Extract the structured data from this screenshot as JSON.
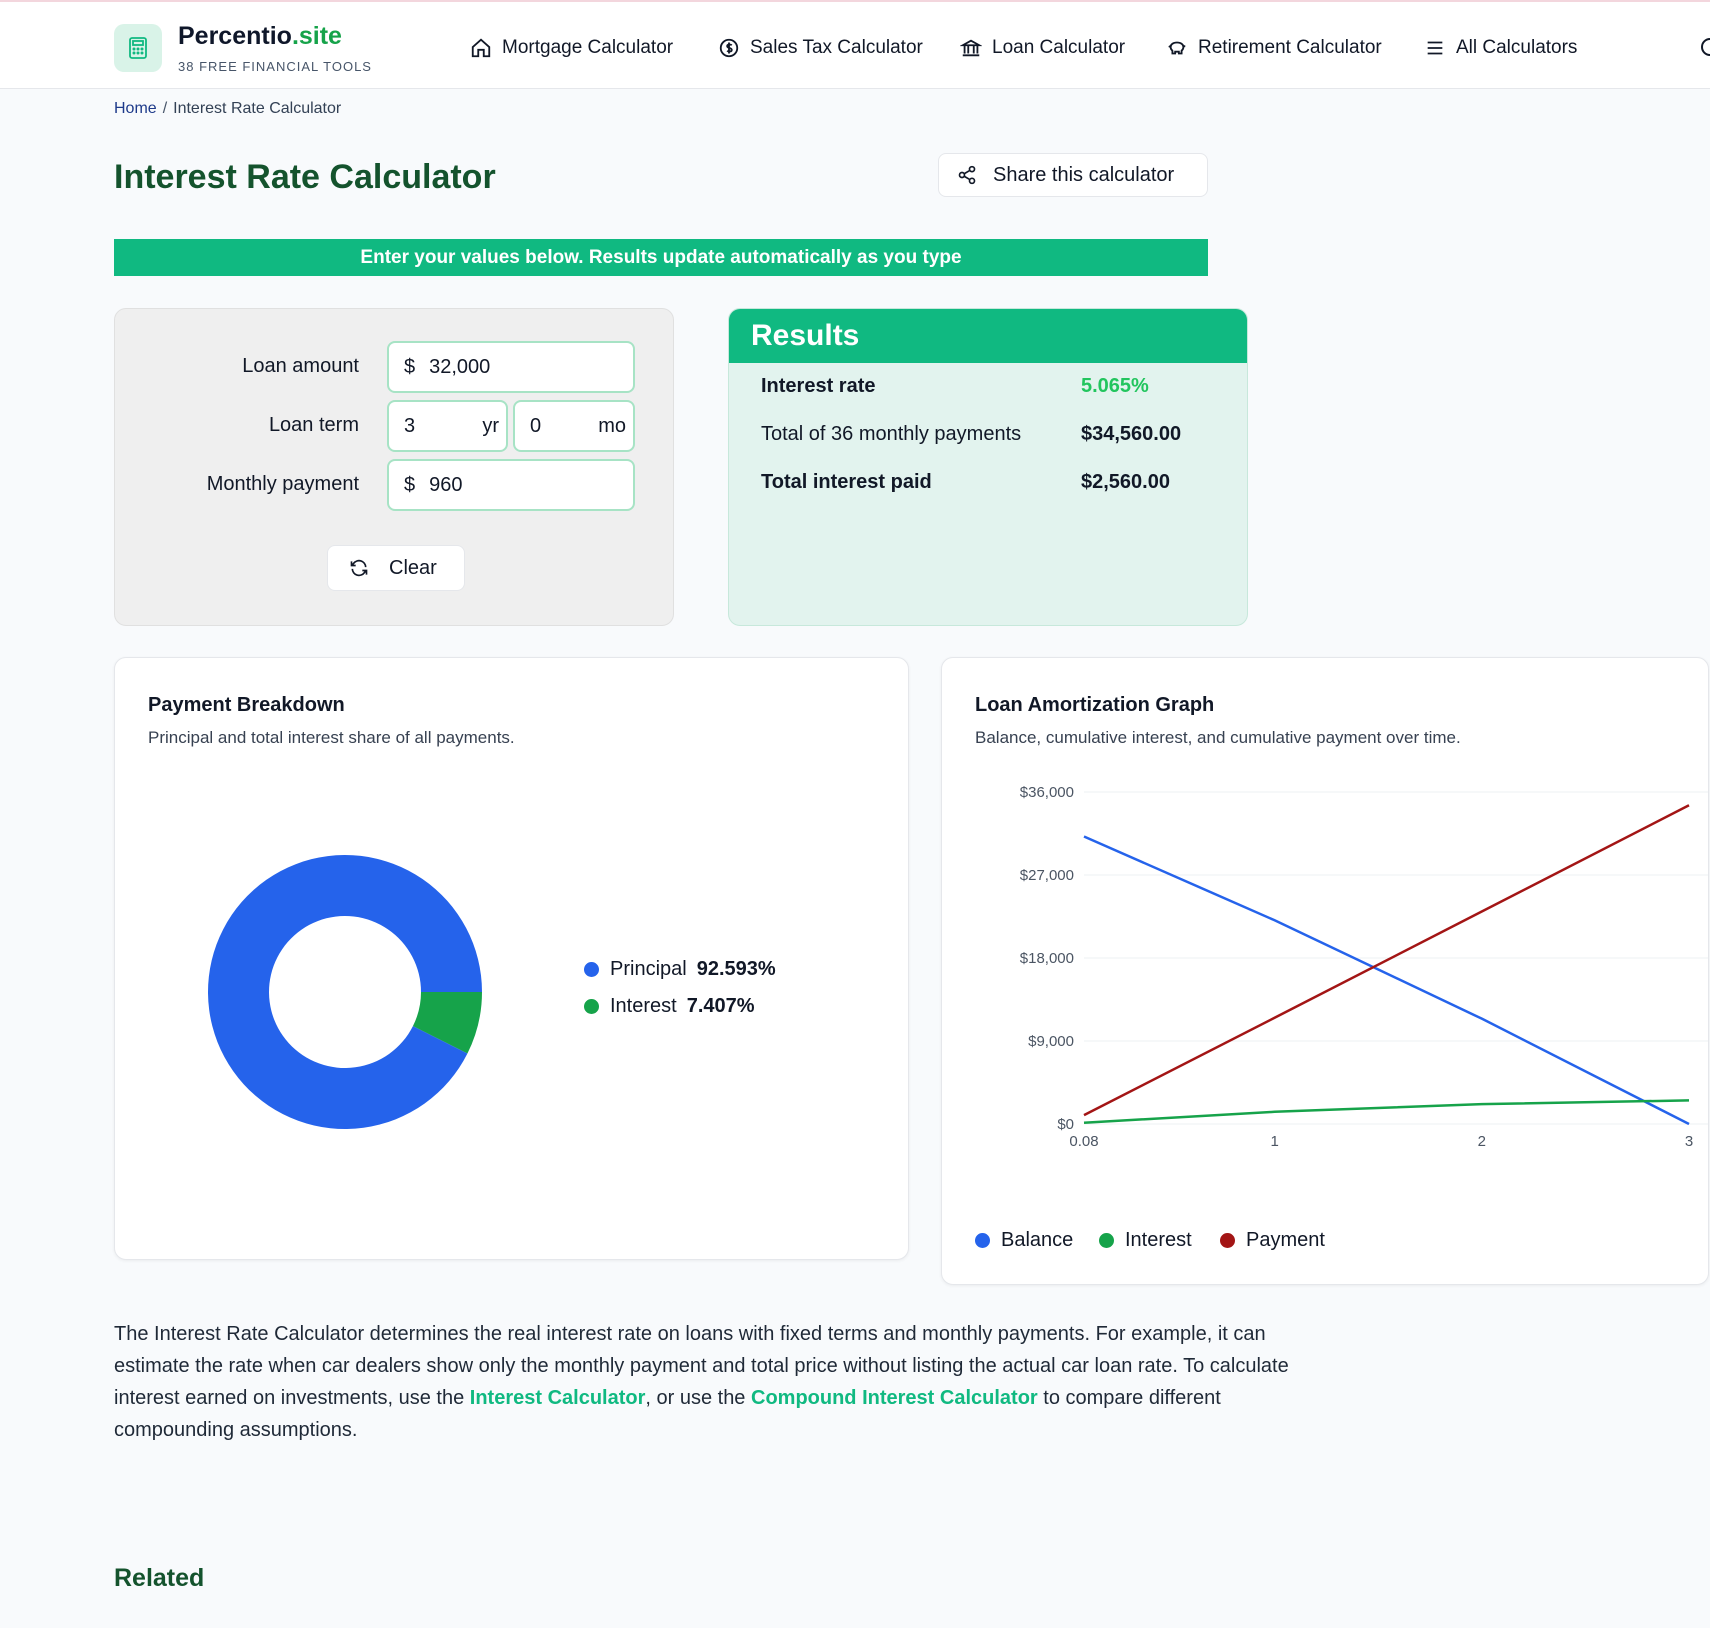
{
  "header": {
    "brand_name": "Percentio",
    "brand_tld": ".site",
    "tagline": "38 FREE FINANCIAL TOOLS",
    "nav": [
      {
        "label": "Mortgage Calculator",
        "icon": "home-icon"
      },
      {
        "label": "Sales Tax Calculator",
        "icon": "dollar-circle-icon"
      },
      {
        "label": "Loan Calculator",
        "icon": "bank-icon"
      },
      {
        "label": "Retirement Calculator",
        "icon": "piggy-bank-icon"
      },
      {
        "label": "All Calculators",
        "icon": "menu-icon"
      }
    ]
  },
  "breadcrumb": {
    "home": "Home",
    "separator": "/",
    "current": "Interest Rate Calculator"
  },
  "page": {
    "title": "Interest Rate Calculator",
    "share_label": "Share this calculator",
    "banner": "Enter your values below. Results update automatically as you type"
  },
  "form": {
    "loan_amount": {
      "label": "Loan amount",
      "prefix": "$",
      "value": "32,000"
    },
    "loan_term": {
      "label": "Loan term",
      "years": "3",
      "years_unit": "yr",
      "months": "0",
      "months_unit": "mo"
    },
    "monthly_payment": {
      "label": "Monthly payment",
      "prefix": "$",
      "value": "960"
    },
    "clear_label": "Clear"
  },
  "results": {
    "title": "Results",
    "rows": [
      {
        "label": "Interest rate",
        "value": "5.065%"
      },
      {
        "label": "Total of 36 monthly payments",
        "value": "$34,560.00"
      },
      {
        "label": "Total interest paid",
        "value": "$2,560.00"
      }
    ]
  },
  "breakdown": {
    "title": "Payment Breakdown",
    "subtitle": "Principal and total interest share of all payments."
  },
  "amortization": {
    "title": "Loan Amortization Graph",
    "subtitle": "Balance, cumulative interest, and cumulative payment over time."
  },
  "colors": {
    "accent": "#10b981",
    "title_green": "#14532d",
    "balance": "#2563eb",
    "interest": "#16a34a",
    "payment": "#a31515"
  },
  "chart_data": [
    {
      "type": "pie",
      "title": "",
      "donut": true,
      "categories": [
        "Principal",
        "Interest"
      ],
      "values": [
        92.593,
        7.407
      ],
      "value_labels": [
        "92.593%",
        "7.407%"
      ],
      "colors": [
        "#2563eb",
        "#16a34a"
      ],
      "legend": "right"
    },
    {
      "type": "line",
      "title": "",
      "xlabel": "",
      "ylabel": "",
      "x": [
        0.08,
        1,
        2,
        3
      ],
      "x_ticks": [
        "0.08",
        "1",
        "2",
        "3"
      ],
      "y_ticks": [
        "$0",
        "$9,000",
        "$18,000",
        "$27,000",
        "$36,000"
      ],
      "xlim": [
        0.08,
        3
      ],
      "ylim": [
        0,
        36000
      ],
      "grid": true,
      "legend": "bottom-left",
      "series": [
        {
          "name": "Balance",
          "color": "#2563eb",
          "values": [
            31175,
            22090,
            11420,
            0
          ]
        },
        {
          "name": "Interest",
          "color": "#16a34a",
          "values": [
            135,
            1322,
            2156,
            2560
          ]
        },
        {
          "name": "Payment",
          "color": "#a31515",
          "values": [
            960,
            11520,
            23040,
            34560
          ]
        }
      ]
    }
  ],
  "description": {
    "text1": "The Interest Rate Calculator determines the real interest rate on loans with fixed terms and monthly payments. For example, it can estimate the rate when car dealers show only the monthly payment and total price without listing the actual car loan rate. To calculate interest earned on investments, use the ",
    "link1": "Interest Calculator",
    "text2": ", or use the ",
    "link2": "Compound Interest Calculator",
    "text3": " to compare different compounding assumptions."
  },
  "related_title": "Related"
}
